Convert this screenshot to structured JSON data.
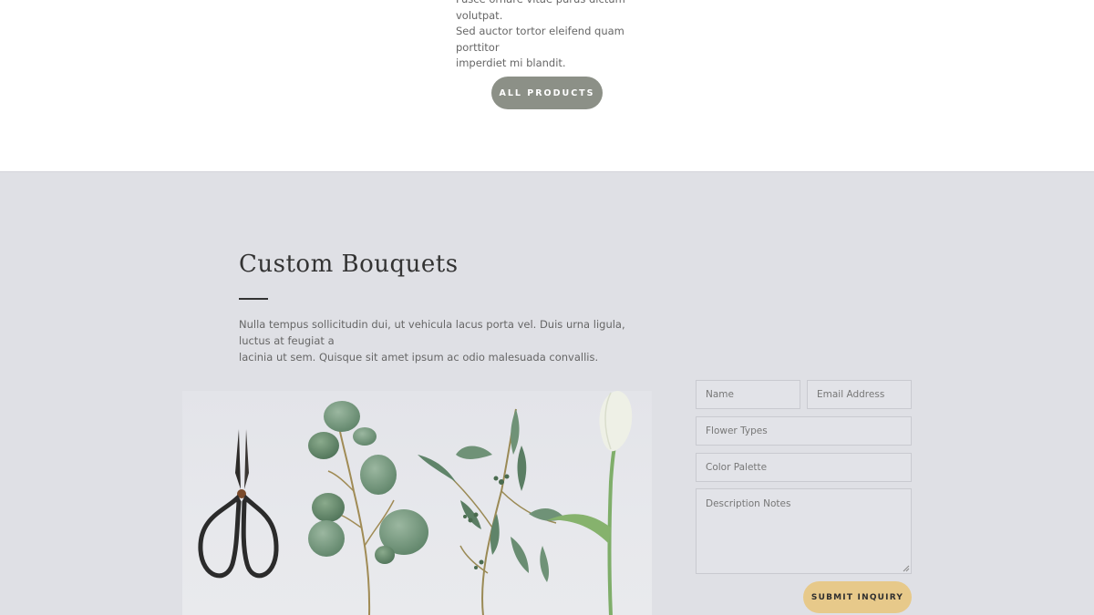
{
  "products_section": {
    "description_lines": [
      "Fusce ornare vitae purus dictum volutpat.",
      "Sed auctor tortor eleifend quam porttitor",
      "imperdiet mi blandit."
    ],
    "button_label": "ALL PRODUCTS"
  },
  "bouquets_section": {
    "heading": "Custom Bouquets",
    "intro_lines": [
      "Nulla tempus sollicitudin dui, ut vehicula lacus porta vel. Duis urna ligula, luctus at feugiat a",
      "lacinia ut sem. Quisque sit amet ipsum ac odio malesuada convallis."
    ]
  },
  "inquiry_form": {
    "name_placeholder": "Name",
    "email_placeholder": "Email Address",
    "flower_types_placeholder": "Flower Types",
    "color_palette_placeholder": "Color Palette",
    "description_placeholder": "Description Notes",
    "submit_label": "SUBMIT INQUIRY"
  },
  "colors": {
    "section_background": "#dfe0e5",
    "products_button": "#8c9087",
    "submit_button": "#e7c98a"
  }
}
